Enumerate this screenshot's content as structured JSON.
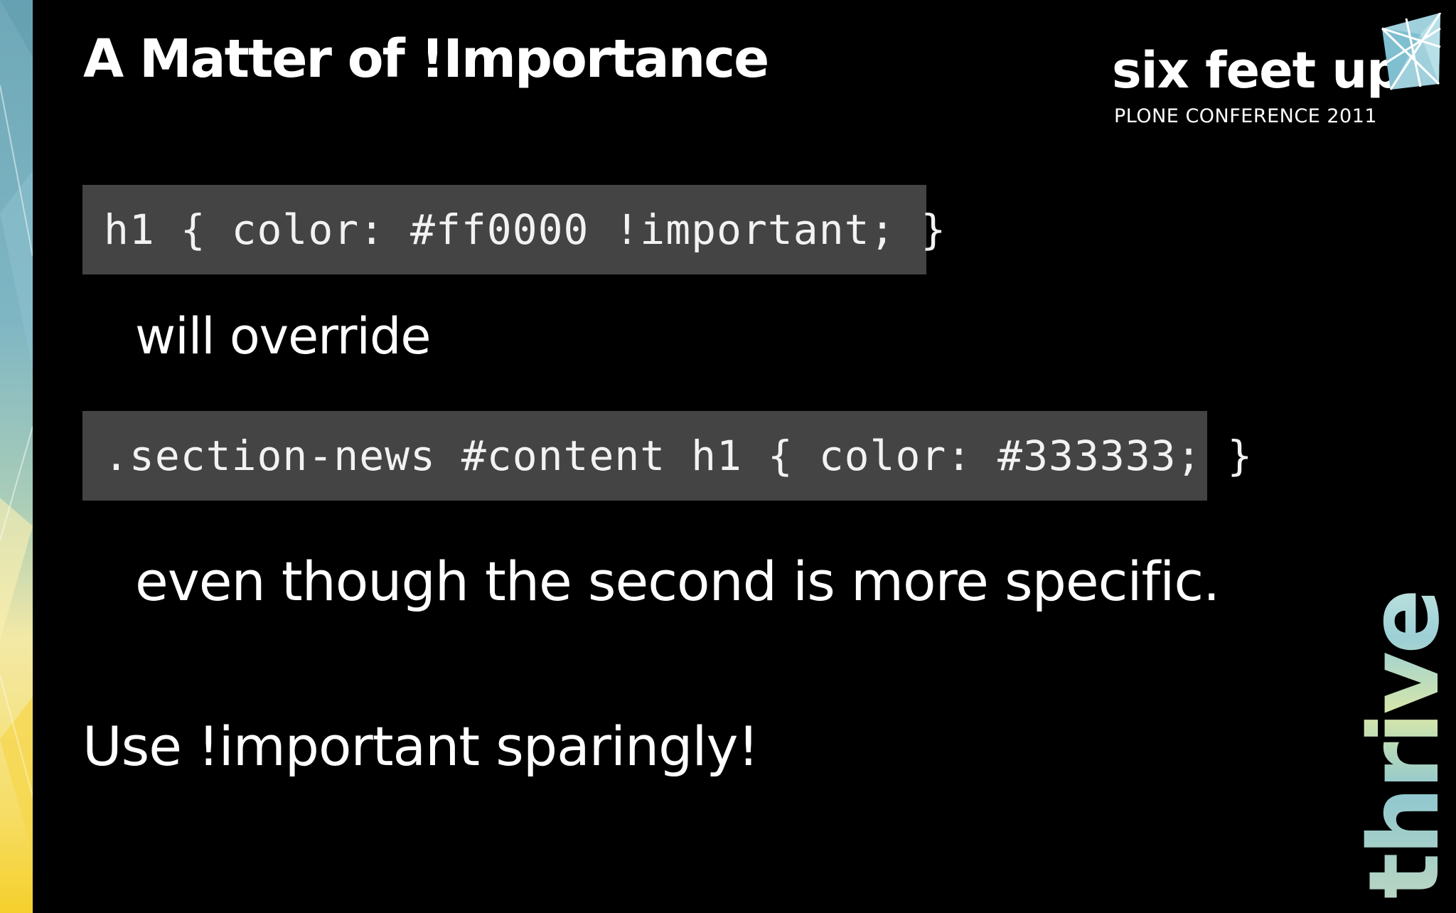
{
  "slide": {
    "title": "A Matter of !Importance",
    "logo_text": "six feet up",
    "conference": "PLONE CONFERENCE 2011",
    "code_1": "h1 { color: #ff0000 !important; }",
    "text_1": "will override",
    "code_2": ".section-news #content h1 { color: #333333; }",
    "text_2": "even though the second is more specific.",
    "text_3": "Use !important sparingly!",
    "brand_word": "thrive"
  },
  "colors": {
    "background": "#000000",
    "code_background": "#444444",
    "text": "#ffffff",
    "accent_teal": "#8fc7cf",
    "accent_yellow": "#f7e06a"
  }
}
